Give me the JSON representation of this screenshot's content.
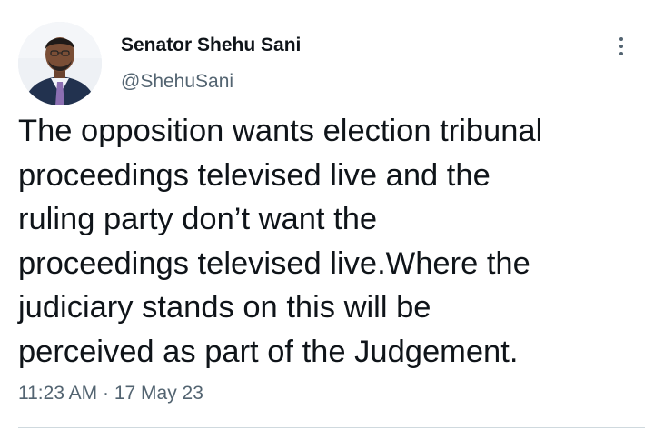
{
  "author": {
    "name": "Senator Shehu Sani",
    "handle": "@ShehuSani",
    "avatar_icon": "profile-photo"
  },
  "tweet": {
    "lines": [
      "The opposition wants election tribunal",
      "proceedings televised live and the",
      "ruling party don’t want the",
      "proceedings televised live.Where the",
      "judiciary stands on this will be",
      "perceived as part of the Judgement."
    ],
    "time": "11:23 AM",
    "separator": "·",
    "date": "17 May 23"
  },
  "icons": {
    "more": "more-vertical-icon"
  },
  "colors": {
    "text_primary": "#0f1419",
    "text_secondary": "#536471",
    "divider": "#cfd9de"
  }
}
